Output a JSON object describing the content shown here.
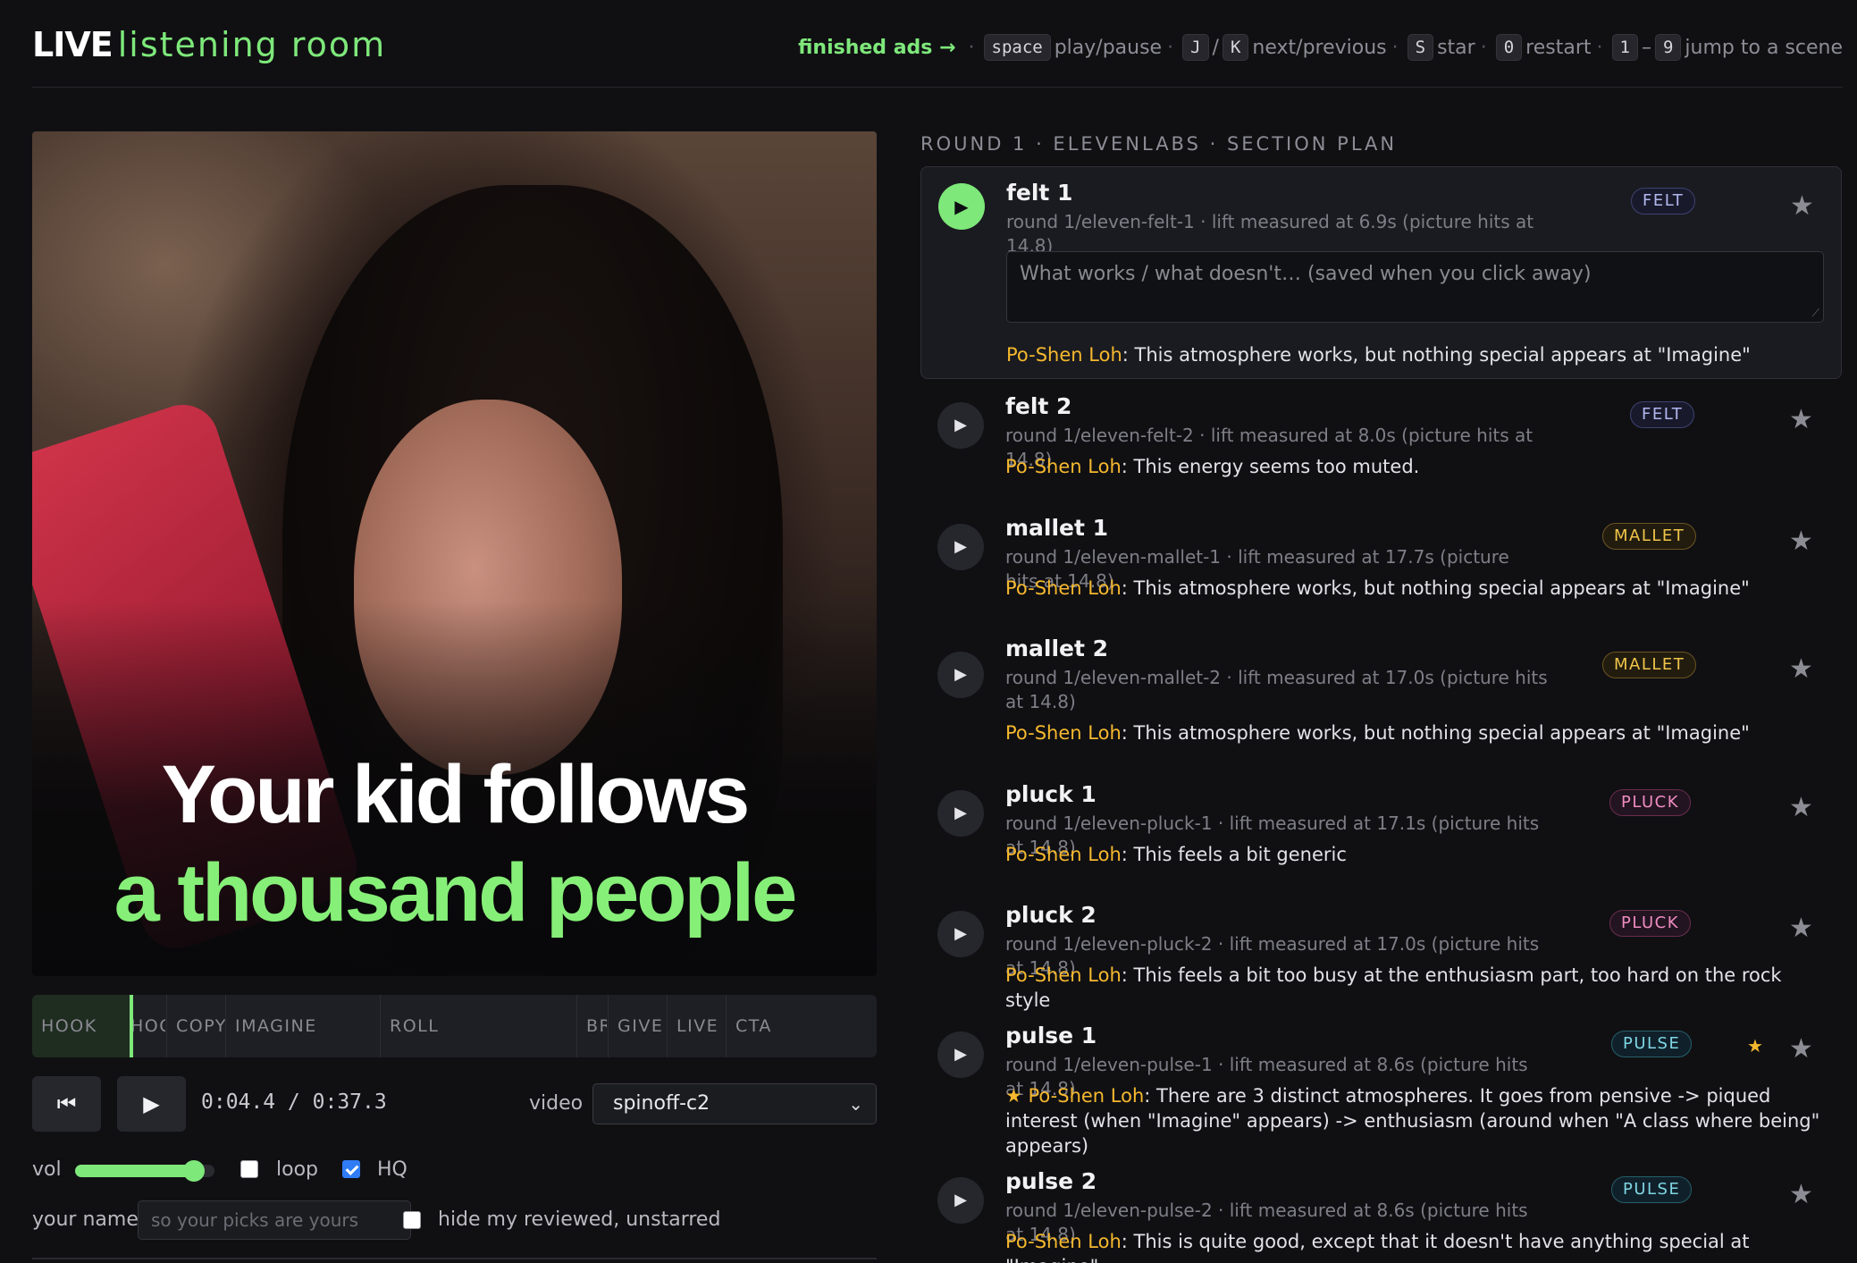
{
  "header": {
    "brand_live": "LIVE",
    "brand_room": "listening room",
    "finished_link": "finished ads →",
    "shortcuts": {
      "space_key": "space",
      "space_label": "play/pause",
      "j_key": "J",
      "slash": "/",
      "k_key": "K",
      "jk_label": "next/previous",
      "s_key": "S",
      "s_label": "star",
      "zero_key": "0",
      "zero_label": "restart",
      "one_key": "1",
      "dash": "–",
      "nine_key": "9",
      "num_label": "jump to a scene",
      "dot": "·"
    }
  },
  "video": {
    "caption_line1": "Your kid follows",
    "caption_line2": "a thousand people",
    "caption_accent": "#86ef78"
  },
  "timeline": {
    "segments": [
      "HOOK",
      "HOOK",
      "COPY",
      "IMAGINE",
      "ROLL",
      "BR",
      "GIVE",
      "LIVE",
      "CTA"
    ],
    "playhead_fraction": 0.118
  },
  "transport": {
    "prev_icon": "skip-back-icon",
    "play_icon": "play-icon",
    "prev_glyph": "⏮",
    "play_glyph": "▶",
    "time": "0:04.4 / 0:37.3",
    "video_label": "video",
    "video_value": "spinoff-c2",
    "chevron_glyph": "⌄"
  },
  "controls": {
    "vol_label": "vol",
    "volume_fraction": 0.85,
    "loop_label": "loop",
    "loop_checked": false,
    "hq_label": "HQ",
    "hq_checked": true,
    "name_label": "your name",
    "name_placeholder": "so your picks are yours",
    "hide_label": "hide my reviewed, unstarred",
    "hide_checked": false
  },
  "section_title": "ROUND 1 · ELEVENLABS · SECTION PLAN",
  "colors": {
    "accent": "#7ee87a",
    "reviewer": "#f5b82e",
    "background": "#101013"
  },
  "tracks": [
    {
      "title": "felt 1",
      "sub": "round 1/eleven-felt-1 · lift measured at 6.9s (picture hits at 14.8)",
      "tag": "FELT",
      "active": true,
      "starred": false,
      "notes_placeholder": "What works / what doesn't… (saved when you click away)",
      "reviewer": "Po-Shen Loh",
      "note": ": This atmosphere works, but nothing special appears at \"Imagine\""
    },
    {
      "title": "felt 2",
      "sub": "round 1/eleven-felt-2 · lift measured at 8.0s (picture hits at 14.8)",
      "tag": "FELT",
      "active": false,
      "starred": false,
      "reviewer": "Po-Shen Loh",
      "note": ": This energy seems too muted."
    },
    {
      "title": "mallet 1",
      "sub": "round 1/eleven-mallet-1 · lift measured at 17.7s (picture hits at 14.8)",
      "tag": "MALLET",
      "active": false,
      "starred": false,
      "reviewer": "Po-Shen Loh",
      "note": ": This atmosphere works, but nothing special appears at \"Imagine\""
    },
    {
      "title": "mallet 2",
      "sub": "round 1/eleven-mallet-2 · lift measured at 17.0s (picture hits at 14.8)",
      "tag": "MALLET",
      "active": false,
      "starred": false,
      "reviewer": "Po-Shen Loh",
      "note": ": This atmosphere works, but nothing special appears at \"Imagine\""
    },
    {
      "title": "pluck 1",
      "sub": "round 1/eleven-pluck-1 · lift measured at 17.1s (picture hits at 14.8)",
      "tag": "PLUCK",
      "active": false,
      "starred": false,
      "reviewer": "Po-Shen Loh",
      "note": ": This feels a bit generic"
    },
    {
      "title": "pluck 2",
      "sub": "round 1/eleven-pluck-2 · lift measured at 17.0s (picture hits at 14.8)",
      "tag": "PLUCK",
      "active": false,
      "starred": false,
      "reviewer": "Po-Shen Loh",
      "note": ": This feels a bit too busy at the enthusiasm part, too hard on the rock style"
    },
    {
      "title": "pulse 1",
      "sub": "round 1/eleven-pulse-1 · lift measured at 8.6s (picture hits at 14.8)",
      "tag": "PULSE",
      "active": false,
      "starred": true,
      "reviewer_star": "★",
      "reviewer": "Po-Shen Loh",
      "note": ": There are 3 distinct atmospheres. It goes from pensive -> piqued interest (when \"Imagine\" appears) -> enthusiasm (around when \"A class where being\" appears)"
    },
    {
      "title": "pulse 2",
      "sub": "round 1/eleven-pulse-2 · lift measured at 8.6s (picture hits at 14.8)",
      "tag": "PULSE",
      "active": false,
      "starred": false,
      "reviewer": "Po-Shen Loh",
      "note": ": This is quite good, except that it doesn't have anything special at \"Imagine\""
    }
  ],
  "glyphs": {
    "play": "▶",
    "star": "★",
    "grip": "⟋"
  }
}
